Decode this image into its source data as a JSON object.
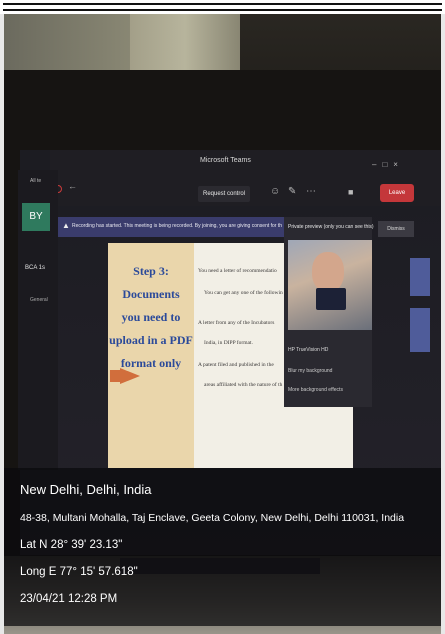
{
  "teams": {
    "title": "Microsoft Teams",
    "request_control": "Request control",
    "leave": "Leave",
    "all_label": "All te",
    "avatar_initials": "BY",
    "team_name": "BCA 1s",
    "channel": "General",
    "banner": "Recording has started. This meeting is being recorded. By joining, you are giving consent for this",
    "preview_title": "Private preview (only you can see this)",
    "dismiss": "Dismiss",
    "camera_device": "HP TrueVision HD",
    "blur_background": "Blur my background",
    "more_effects": "More background effects"
  },
  "slide": {
    "heading_lines": [
      "Step 3: Documents",
      "you need to",
      "upload in a PDF",
      "format only"
    ],
    "bullets": [
      "You need a letter of recommendatio",
      "You can get any one of the followin",
      "A letter from any of the Incubators",
      "India, in DIPP format.",
      "A patent filed and published in the",
      "areas affiliated with the nature of th"
    ]
  },
  "location": {
    "city": "New Delhi, Delhi, India",
    "address": "48-38, Multani Mohalla, Taj Enclave, Geeta Colony, New Delhi, Delhi 110031, India",
    "lat": "Lat N 28° 39' 23.13\"",
    "long": "Long E 77° 15' 57.618\"",
    "datetime": "23/04/21 12:28 PM"
  },
  "colors": {
    "leave_red": "#c4373a",
    "banner_purple": "#3a3c6c",
    "slide_heading_blue": "#2b4a9a",
    "avatar_green": "#2f7a5e"
  }
}
